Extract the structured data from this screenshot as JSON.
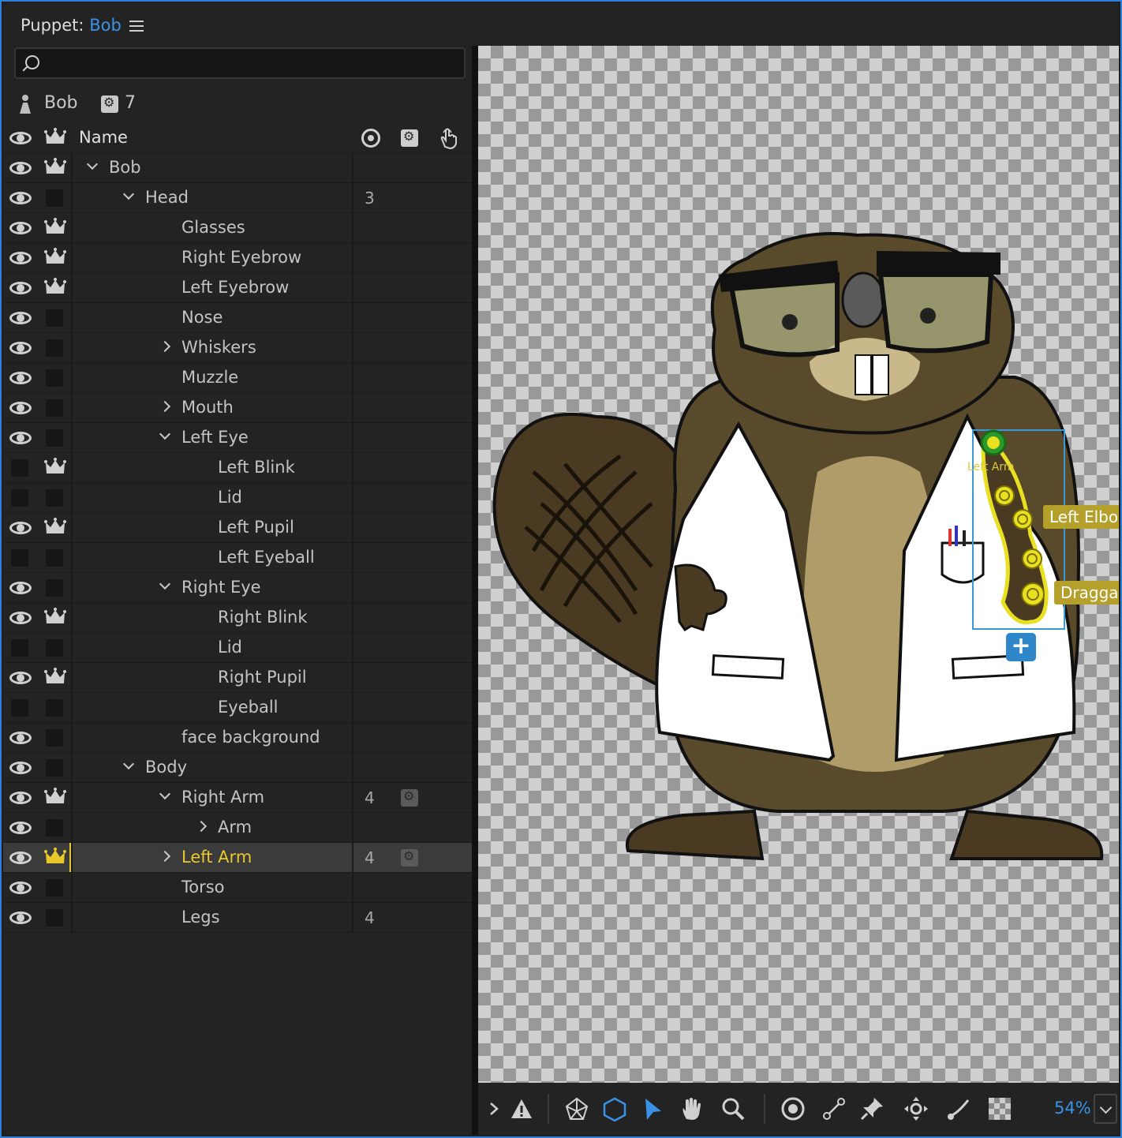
{
  "header": {
    "label": "Puppet:",
    "puppet_name": "Bob"
  },
  "search": {
    "placeholder": ""
  },
  "puppet_info": {
    "name": "Bob",
    "behavior_count": "7"
  },
  "table": {
    "columns": {
      "name": "Name"
    },
    "rows": [
      {
        "name": "Bob",
        "depth": 0,
        "expander": "down",
        "eye": true,
        "crown": true,
        "count": "",
        "behavior": false,
        "selected": false
      },
      {
        "name": "Head",
        "depth": 1,
        "expander": "down",
        "eye": true,
        "crown": false,
        "count": "3",
        "behavior": false,
        "selected": false
      },
      {
        "name": "Glasses",
        "depth": 2,
        "expander": "",
        "eye": true,
        "crown": true,
        "count": "",
        "behavior": false,
        "selected": false
      },
      {
        "name": "Right Eyebrow",
        "depth": 2,
        "expander": "",
        "eye": true,
        "crown": true,
        "count": "",
        "behavior": false,
        "selected": false
      },
      {
        "name": "Left Eyebrow",
        "depth": 2,
        "expander": "",
        "eye": true,
        "crown": true,
        "count": "",
        "behavior": false,
        "selected": false
      },
      {
        "name": "Nose",
        "depth": 2,
        "expander": "",
        "eye": true,
        "crown": false,
        "count": "",
        "behavior": false,
        "selected": false
      },
      {
        "name": "Whiskers",
        "depth": 2,
        "expander": "right",
        "eye": true,
        "crown": false,
        "count": "",
        "behavior": false,
        "selected": false
      },
      {
        "name": "Muzzle",
        "depth": 2,
        "expander": "",
        "eye": true,
        "crown": false,
        "count": "",
        "behavior": false,
        "selected": false
      },
      {
        "name": "Mouth",
        "depth": 2,
        "expander": "right",
        "eye": true,
        "crown": false,
        "count": "",
        "behavior": false,
        "selected": false
      },
      {
        "name": "Left Eye",
        "depth": 2,
        "expander": "down",
        "eye": true,
        "crown": false,
        "count": "",
        "behavior": false,
        "selected": false
      },
      {
        "name": "Left Blink",
        "depth": 3,
        "expander": "",
        "eye": false,
        "crown": true,
        "count": "",
        "behavior": false,
        "selected": false
      },
      {
        "name": "Lid",
        "depth": 3,
        "expander": "",
        "eye": false,
        "crown": false,
        "count": "",
        "behavior": false,
        "selected": false
      },
      {
        "name": "Left Pupil",
        "depth": 3,
        "expander": "",
        "eye": true,
        "crown": true,
        "count": "",
        "behavior": false,
        "selected": false
      },
      {
        "name": "Left Eyeball",
        "depth": 3,
        "expander": "",
        "eye": false,
        "crown": false,
        "count": "",
        "behavior": false,
        "selected": false
      },
      {
        "name": "Right Eye",
        "depth": 2,
        "expander": "down",
        "eye": true,
        "crown": false,
        "count": "",
        "behavior": false,
        "selected": false
      },
      {
        "name": "Right Blink",
        "depth": 3,
        "expander": "",
        "eye": true,
        "crown": true,
        "count": "",
        "behavior": false,
        "selected": false
      },
      {
        "name": "Lid",
        "depth": 3,
        "expander": "",
        "eye": false,
        "crown": false,
        "count": "",
        "behavior": false,
        "selected": false
      },
      {
        "name": "Right Pupil",
        "depth": 3,
        "expander": "",
        "eye": true,
        "crown": true,
        "count": "",
        "behavior": false,
        "selected": false
      },
      {
        "name": "Eyeball",
        "depth": 3,
        "expander": "",
        "eye": false,
        "crown": false,
        "count": "",
        "behavior": false,
        "selected": false
      },
      {
        "name": "face background",
        "depth": 2,
        "expander": "",
        "eye": true,
        "crown": false,
        "count": "",
        "behavior": false,
        "selected": false
      },
      {
        "name": "Body",
        "depth": 1,
        "expander": "down",
        "eye": true,
        "crown": false,
        "count": "",
        "behavior": false,
        "selected": false
      },
      {
        "name": "Right Arm",
        "depth": 2,
        "expander": "down",
        "eye": true,
        "crown": true,
        "count": "4",
        "behavior": true,
        "selected": false
      },
      {
        "name": "Arm",
        "depth": 3,
        "expander": "right",
        "eye": true,
        "crown": false,
        "count": "",
        "behavior": false,
        "selected": false
      },
      {
        "name": "Left Arm",
        "depth": 2,
        "expander": "right",
        "eye": true,
        "crown": true,
        "count": "4",
        "behavior": true,
        "selected": true
      },
      {
        "name": "Torso",
        "depth": 2,
        "expander": "",
        "eye": true,
        "crown": false,
        "count": "",
        "behavior": false,
        "selected": false
      },
      {
        "name": "Legs",
        "depth": 2,
        "expander": "",
        "eye": true,
        "crown": false,
        "count": "4",
        "behavior": false,
        "selected": false
      }
    ]
  },
  "scene": {
    "handle_labels": {
      "left_arm": "Left Arm",
      "left_elbow": "Left Elbo",
      "draggable": "Draggal"
    },
    "add_button": "+"
  },
  "toolbar": {
    "tools": [
      "expand-icon",
      "warning-icon",
      "mesh-icon",
      "shape-icon",
      "select-icon",
      "hand-icon",
      "zoom-icon",
      "origin-icon",
      "stick-icon",
      "pin-icon",
      "drag-icon",
      "path-icon",
      "checker-icon"
    ],
    "zoom": "54%"
  },
  "colors": {
    "accent": "#3a92e6",
    "selected_text": "#e9c82c",
    "handle": "#e8e020",
    "beaver_fur": "#5a4a2c",
    "belly": "#b09c68"
  }
}
